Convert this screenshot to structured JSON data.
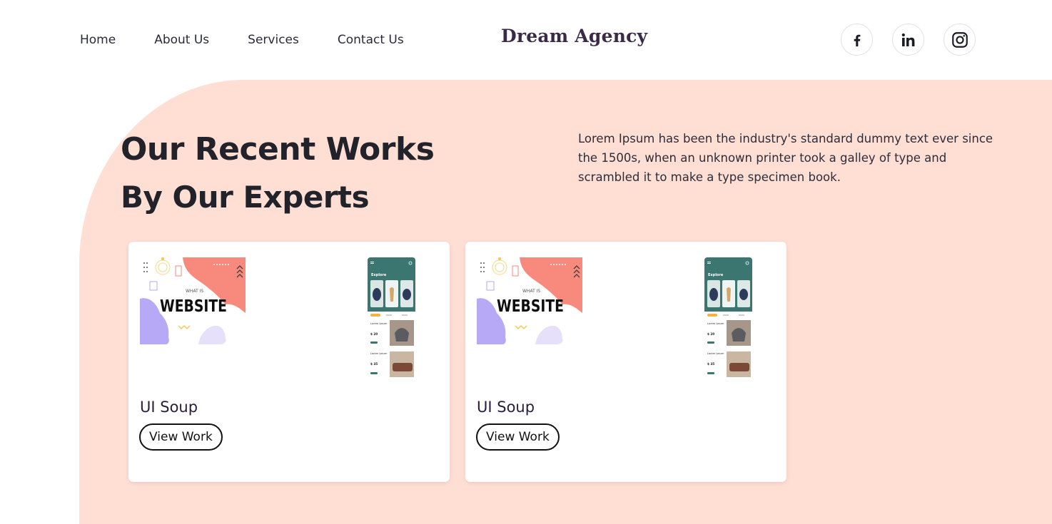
{
  "header": {
    "nav": [
      "Home",
      "About Us",
      "Services",
      "Contact Us"
    ],
    "brand": "Dream Agency",
    "socials": [
      "facebook-icon",
      "linkedin-icon",
      "instagram-icon"
    ]
  },
  "hero": {
    "title": "Our Recent Works",
    "subtitle_prefix": "By Our",
    "subtitle_highlight": "Experts",
    "description": "Lorem Ipsum has been the industry's standard dummy text ever since the 1500s, when an unknown printer took a galley of type and scrambled it to make a type specimen book."
  },
  "cards": [
    {
      "title": "UI Soup",
      "button": "View Work",
      "thumb_a_text_small": "WHAT IS",
      "thumb_a_text_big": "WEBSITE",
      "thumb_b_header": "Explore",
      "thumb_b_items": [
        {
          "name": "Lorem Ipsum",
          "price": "$ 20"
        },
        {
          "name": "Lorem Ipsum",
          "price": "$ 35"
        }
      ]
    },
    {
      "title": "UI Soup",
      "button": "View Work",
      "thumb_a_text_small": "WHAT IS",
      "thumb_a_text_big": "WEBSITE",
      "thumb_b_header": "Explore",
      "thumb_b_items": [
        {
          "name": "Lorem Ipsum",
          "price": "$ 20"
        },
        {
          "name": "Lorem Ipsum",
          "price": "$ 35"
        }
      ]
    }
  ],
  "colors": {
    "section_bg": "#ffded4",
    "highlight": "#ffc22a",
    "brand_text": "#3a2a48",
    "app_teal": "#3c7670",
    "thumb_salmon": "#f7897d",
    "thumb_lilac": "#b7a9f5"
  }
}
